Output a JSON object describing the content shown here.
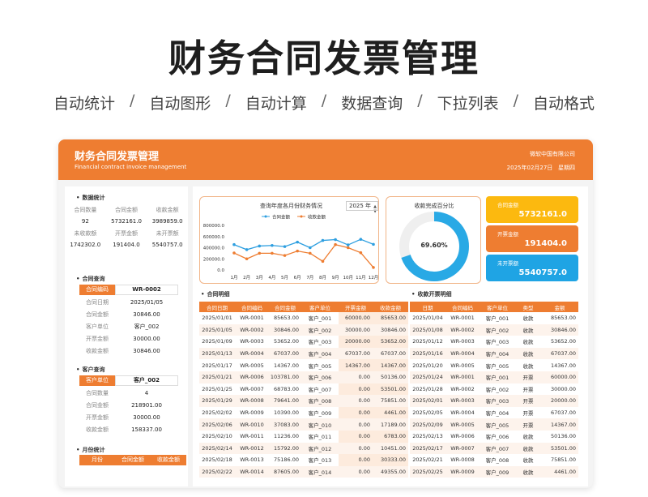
{
  "banner": {
    "title": "财务合同发票管理",
    "features": [
      "自动统计",
      "自动图形",
      "自动计算",
      "数据查询",
      "下拉列表",
      "自动格式"
    ],
    "separator": "/"
  },
  "header": {
    "title": "财务合同发票管理",
    "subtitle": "Financial contract invoice management",
    "company": "微软中国有限公司",
    "date": "2025年02月27日",
    "weekday": "星期四"
  },
  "stats": {
    "section": "数据统计",
    "row1_labels": [
      "合同数量",
      "合同金额",
      "收款金额"
    ],
    "row1_values": [
      "92",
      "5732161.0",
      "3989859.0"
    ],
    "row2_labels": [
      "未收款额",
      "开票金额",
      "未开票额"
    ],
    "row2_values": [
      "1742302.0",
      "191404.0",
      "5540757.0"
    ]
  },
  "contract_query": {
    "section": "合同查询",
    "key_label": "合同编码",
    "key_value": "WR-0002",
    "rows": [
      {
        "k": "合同日期",
        "v": "2025/01/05"
      },
      {
        "k": "合同金额",
        "v": "30846.00"
      },
      {
        "k": "客户单位",
        "v": "客户_002"
      },
      {
        "k": "开票金额",
        "v": "30000.00"
      },
      {
        "k": "收款金额",
        "v": "30846.00"
      }
    ]
  },
  "customer_query": {
    "section": "客户查询",
    "key_label": "客户单位",
    "key_value": "客户_002",
    "rows": [
      {
        "k": "合同数量",
        "v": "4"
      },
      {
        "k": "合同金额",
        "v": "218901.00"
      },
      {
        "k": "开票金额",
        "v": "30000.00"
      },
      {
        "k": "收款金额",
        "v": "158337.00"
      }
    ]
  },
  "monthly": {
    "section": "月份统计",
    "headers": [
      "月份",
      "合同金额",
      "收款金额"
    ]
  },
  "chart": {
    "title": "查询年度各月份财务情况",
    "year": "2025 年",
    "legend": [
      "合同金额",
      "收款金额"
    ]
  },
  "chart_data": {
    "type": "line",
    "title": "查询年度各月份财务情况",
    "categories": [
      "1月",
      "2月",
      "3月",
      "4月",
      "5月",
      "6月",
      "7月",
      "8月",
      "9月",
      "10月",
      "11月",
      "12月"
    ],
    "series": [
      {
        "name": "合同金额",
        "color": "#2e9fe0",
        "values": [
          455000,
          365000,
          430000,
          440000,
          420000,
          500000,
          400000,
          530000,
          545000,
          450000,
          550000,
          460000
        ]
      },
      {
        "name": "收款金额",
        "color": "#ee7d31",
        "values": [
          305000,
          200000,
          300000,
          300000,
          260000,
          340000,
          300000,
          155000,
          455000,
          400000,
          310000,
          45000
        ]
      }
    ],
    "yticks": [
      "800000.0",
      "600000.0",
      "400000.0",
      "200000.0",
      "0.0"
    ],
    "ylim": [
      0,
      800000
    ]
  },
  "donut": {
    "title": "收款完成百分比",
    "value_label": "69.60%",
    "fraction": 0.696,
    "color": "#29a9e5"
  },
  "cards": [
    {
      "label": "合同金额",
      "value": "5732161.0",
      "color": "#fcb90f"
    },
    {
      "label": "开票金额",
      "value": "191404.0",
      "color": "#ee7d31"
    },
    {
      "label": "未开票额",
      "value": "5540757.0",
      "color": "#1fa4e4"
    }
  ],
  "contracts": {
    "section": "合同明细",
    "headers": [
      "合同日期",
      "合同编码",
      "合同金额",
      "客户单位",
      "开票金额",
      "收款金额"
    ],
    "rows": [
      [
        "2025/01/01",
        "WR-0001",
        "85653.00",
        "客户_001",
        "60000.00",
        "85653.00"
      ],
      [
        "2025/01/05",
        "WR-0002",
        "30846.00",
        "客户_002",
        "30000.00",
        "30846.00"
      ],
      [
        "2025/01/09",
        "WR-0003",
        "53652.00",
        "客户_003",
        "20000.00",
        "53652.00"
      ],
      [
        "2025/01/13",
        "WR-0004",
        "67037.00",
        "客户_004",
        "67037.00",
        "67037.00"
      ],
      [
        "2025/01/17",
        "WR-0005",
        "14367.00",
        "客户_005",
        "14367.00",
        "14367.00"
      ],
      [
        "2025/01/21",
        "WR-0006",
        "103781.00",
        "客户_006",
        "0.00",
        "50136.00"
      ],
      [
        "2025/01/25",
        "WR-0007",
        "68783.00",
        "客户_007",
        "0.00",
        "53501.00"
      ],
      [
        "2025/01/29",
        "WR-0008",
        "79641.00",
        "客户_008",
        "0.00",
        "75851.00"
      ],
      [
        "2025/02/02",
        "WR-0009",
        "10390.00",
        "客户_009",
        "0.00",
        "4461.00"
      ],
      [
        "2025/02/06",
        "WR-0010",
        "37083.00",
        "客户_010",
        "0.00",
        "17189.00"
      ],
      [
        "2025/02/10",
        "WR-0011",
        "11236.00",
        "客户_011",
        "0.00",
        "6783.00"
      ],
      [
        "2025/02/14",
        "WR-0012",
        "15792.00",
        "客户_012",
        "0.00",
        "10451.00"
      ],
      [
        "2025/02/18",
        "WR-0013",
        "75186.00",
        "客户_013",
        "0.00",
        "30333.00"
      ],
      [
        "2025/02/22",
        "WR-0014",
        "87605.00",
        "客户_014",
        "0.00",
        "49355.00"
      ]
    ]
  },
  "receipts": {
    "section": "收款开票明细",
    "headers": [
      "日期",
      "合同编码",
      "客户单位",
      "类型",
      "金额"
    ],
    "rows": [
      [
        "2025/01/04",
        "WR-0001",
        "客户_001",
        "收款",
        "85653.00"
      ],
      [
        "2025/01/08",
        "WR-0002",
        "客户_002",
        "收款",
        "30846.00"
      ],
      [
        "2025/01/12",
        "WR-0003",
        "客户_003",
        "收款",
        "53652.00"
      ],
      [
        "2025/01/16",
        "WR-0004",
        "客户_004",
        "收款",
        "67037.00"
      ],
      [
        "2025/01/20",
        "WR-0005",
        "客户_005",
        "收款",
        "14367.00"
      ],
      [
        "2025/01/24",
        "WR-0001",
        "客户_001",
        "开票",
        "60000.00"
      ],
      [
        "2025/01/28",
        "WR-0002",
        "客户_002",
        "开票",
        "30000.00"
      ],
      [
        "2025/02/01",
        "WR-0003",
        "客户_003",
        "开票",
        "20000.00"
      ],
      [
        "2025/02/05",
        "WR-0004",
        "客户_004",
        "开票",
        "67037.00"
      ],
      [
        "2025/02/09",
        "WR-0005",
        "客户_005",
        "开票",
        "14367.00"
      ],
      [
        "2025/02/13",
        "WR-0006",
        "客户_006",
        "收款",
        "50136.00"
      ],
      [
        "2025/02/17",
        "WR-0007",
        "客户_007",
        "收款",
        "53501.00"
      ],
      [
        "2025/02/21",
        "WR-0008",
        "客户_008",
        "收款",
        "75851.00"
      ],
      [
        "2025/02/25",
        "WR-0009",
        "客户_009",
        "收款",
        "4461.00"
      ]
    ]
  }
}
